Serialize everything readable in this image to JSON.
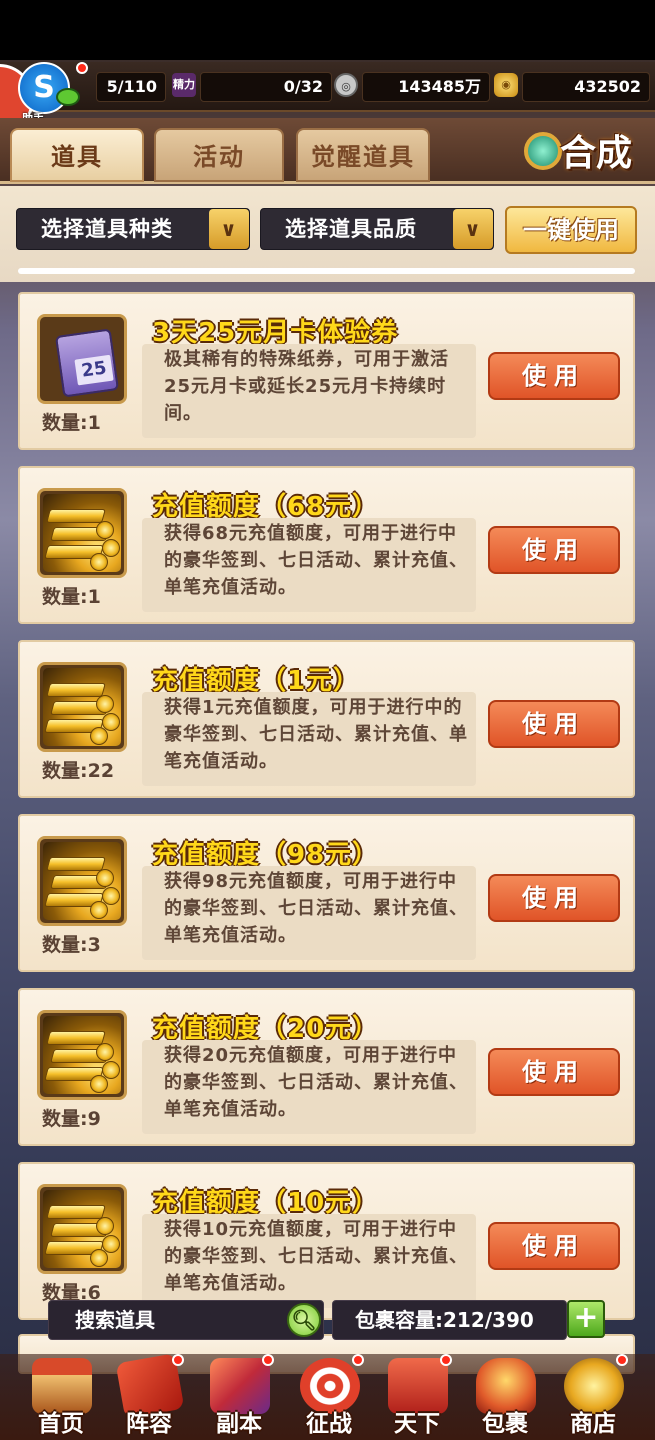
{
  "header": {
    "helper_text": "助手",
    "avatar_glyph": "S",
    "stat1": "5/110",
    "stat_mid_label": "精力",
    "stat2": "0/32",
    "stat3": "143485万",
    "stat4": "432502"
  },
  "tabs": [
    {
      "label": "道具",
      "active": true
    },
    {
      "label": "活动",
      "active": false
    },
    {
      "label": "觉醒道具",
      "active": false
    }
  ],
  "compose_label": "合成",
  "filters": {
    "type_label": "选择道具种类",
    "quality_label": "选择道具品质",
    "arrow_glyph": "∨",
    "use_all_label": "一键使用"
  },
  "items": [
    {
      "title": "3天25元月卡体验券",
      "desc": "极其稀有的特殊纸券，可用于激活25元月卡或延长25元月卡持续时间。",
      "qty": "数量:1",
      "icon": "voucher-icon",
      "voucher_number": "25",
      "use_label": "使用"
    },
    {
      "title": "充值额度（68元）",
      "desc": "获得68元充值额度，可用于进行中的豪华签到、七日活动、累计充值、单笔充值活动。",
      "qty": "数量:1",
      "icon": "gold-bars-icon",
      "use_label": "使用"
    },
    {
      "title": "充值额度（1元）",
      "desc": "获得1元充值额度，可用于进行中的豪华签到、七日活动、累计充值、单笔充值活动。",
      "qty": "数量:22",
      "icon": "gold-bars-icon",
      "use_label": "使用"
    },
    {
      "title": "充值额度（98元）",
      "desc": "获得98元充值额度，可用于进行中的豪华签到、七日活动、累计充值、单笔充值活动。",
      "qty": "数量:3",
      "icon": "gold-bars-icon",
      "use_label": "使用"
    },
    {
      "title": "充值额度（20元）",
      "desc": "获得20元充值额度，可用于进行中的豪华签到、七日活动、累计充值、单笔充值活动。",
      "qty": "数量:9",
      "icon": "gold-bars-icon",
      "use_label": "使用"
    },
    {
      "title": "充值额度（10元）",
      "desc": "获得10元充值额度，可用于进行中的豪华签到、七日活动、累计充值、单笔充值活动。",
      "qty": "数量:6",
      "icon": "gold-bars-icon",
      "use_label": "使用"
    }
  ],
  "bottom": {
    "search_placeholder": "搜索道具",
    "capacity_text": "包裹容量:212/390",
    "plus_glyph": "+"
  },
  "nav": [
    {
      "label": "首页",
      "icon": "palace-icon",
      "badge": false
    },
    {
      "label": "阵容",
      "icon": "flag-icon",
      "badge": true
    },
    {
      "label": "副本",
      "icon": "dragon-icon",
      "badge": true
    },
    {
      "label": "征战",
      "icon": "target-icon",
      "badge": true
    },
    {
      "label": "天下",
      "icon": "scroll-icon",
      "badge": true
    },
    {
      "label": "包裹",
      "icon": "bag-icon",
      "badge": false,
      "active": true
    },
    {
      "label": "商店",
      "icon": "coins-icon",
      "badge": true
    }
  ],
  "colors": {
    "title_yellow": "#ffd81a",
    "use_button": "#e05428",
    "card_bg": "#fbf2e4",
    "panel_dark": "#2e2a33"
  }
}
